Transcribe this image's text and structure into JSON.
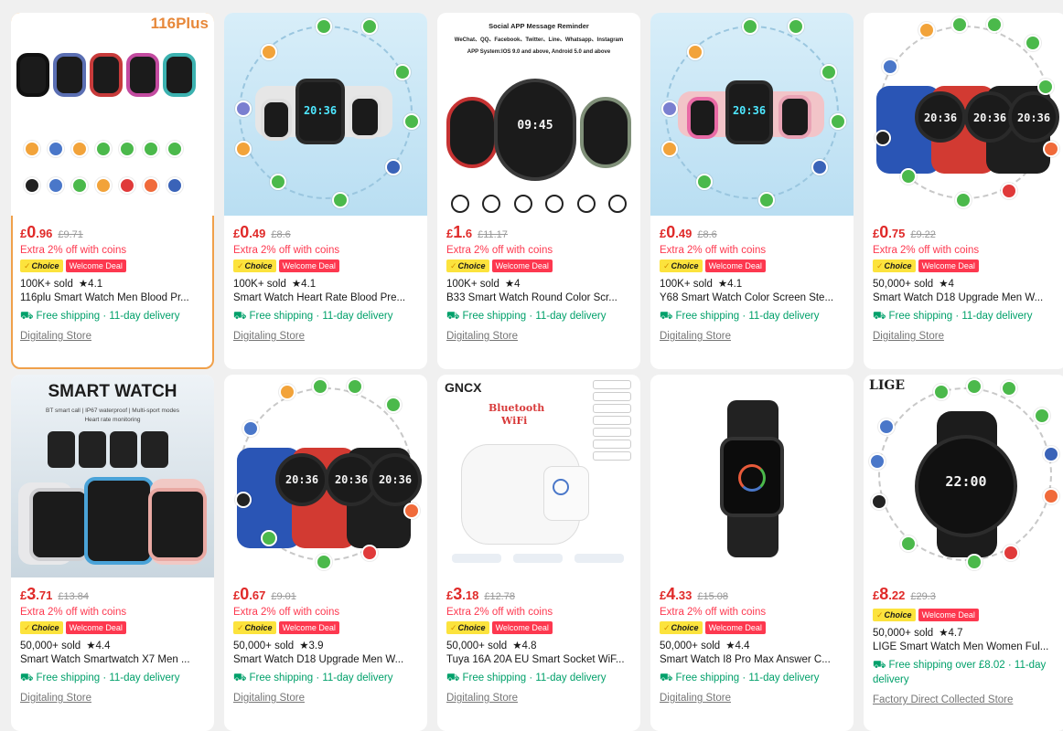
{
  "products": [
    {
      "price_symbol": "£",
      "price_int": "0",
      "price_dec": ".96",
      "orig_price": "£9.71",
      "promo": "Extra 2% off with coins",
      "choice": "Choice",
      "deal": "Welcome Deal",
      "sold": "100K+ sold",
      "rating": "★4.1",
      "title": "116plu Smart Watch Men Blood Pr...",
      "shipping": "Free shipping · 11-day delivery",
      "store": "Digitaling Store",
      "image_text": "116Plus"
    },
    {
      "price_symbol": "£",
      "price_int": "0",
      "price_dec": ".49",
      "orig_price": "£8.6",
      "promo": "Extra 2% off with coins",
      "choice": "Choice",
      "deal": "Welcome Deal",
      "sold": "100K+ sold",
      "rating": "★4.1",
      "title": "Smart Watch Heart Rate Blood Pre...",
      "shipping": "Free shipping · 11-day delivery",
      "store": "Digitaling Store",
      "image_text": "20:36"
    },
    {
      "price_symbol": "£",
      "price_int": "1",
      "price_dec": ".6",
      "orig_price": "£11.17",
      "promo": "Extra 2% off with coins",
      "choice": "Choice",
      "deal": "Welcome Deal",
      "sold": "100K+ sold",
      "rating": "★4",
      "title": "B33 Smart Watch Round Color Scr...",
      "shipping": "Free shipping · 11-day delivery",
      "store": "Digitaling Store",
      "image_text": "Social APP Message Reminder",
      "image_subtext": "WeChat、QQ、Facebook、Twitter、Line、Whatsapp、Instagram",
      "image_subtext2": "APP System:IOS 9.0 and above, Android 5.0 and above"
    },
    {
      "price_symbol": "£",
      "price_int": "0",
      "price_dec": ".49",
      "orig_price": "£8.6",
      "promo": "Extra 2% off with coins",
      "choice": "Choice",
      "deal": "Welcome Deal",
      "sold": "100K+ sold",
      "rating": "★4.1",
      "title": "Y68 Smart Watch Color Screen Ste...",
      "shipping": "Free shipping · 11-day delivery",
      "store": "Digitaling Store",
      "image_text": "20:36"
    },
    {
      "price_symbol": "£",
      "price_int": "0",
      "price_dec": ".75",
      "orig_price": "£9.22",
      "promo": "Extra 2% off with coins",
      "choice": "Choice",
      "deal": "Welcome Deal",
      "sold": "50,000+ sold",
      "rating": "★4",
      "title": "Smart Watch D18 Upgrade Men W...",
      "shipping": "Free shipping · 11-day delivery",
      "store": "Digitaling Store",
      "image_text": "20:36"
    },
    {
      "price_symbol": "£",
      "price_int": "3",
      "price_dec": ".71",
      "orig_price": "£13.84",
      "promo": "Extra 2% off with coins",
      "choice": "Choice",
      "deal": "Welcome Deal",
      "sold": "50,000+ sold",
      "rating": "★4.4",
      "title": "Smart Watch Smartwatch X7 Men ...",
      "shipping": "Free shipping · 11-day delivery",
      "store": "Digitaling Store",
      "image_text": "SMART WATCH",
      "image_subtext": "BT smart call | IP67 waterproof | Multi-sport modes",
      "image_subtext2": "Heart rate monitoring"
    },
    {
      "price_symbol": "£",
      "price_int": "0",
      "price_dec": ".67",
      "orig_price": "£9.01",
      "promo": "Extra 2% off with coins",
      "choice": "Choice",
      "deal": "Welcome Deal",
      "sold": "50,000+ sold",
      "rating": "★3.9",
      "title": "Smart Watch D18 Upgrade Men W...",
      "shipping": "Free shipping · 11-day delivery",
      "store": "Digitaling Store",
      "image_text": "20:36"
    },
    {
      "price_symbol": "£",
      "price_int": "3",
      "price_dec": ".18",
      "orig_price": "£12.78",
      "promo": "Extra 2% off with coins",
      "choice": "Choice",
      "deal": "Welcome Deal",
      "sold": "50,000+ sold",
      "rating": "★4.8",
      "title": "Tuya 16A 20A EU Smart Socket WiF...",
      "shipping": "Free shipping · 11-day delivery",
      "store": "Digitaling Store",
      "image_text": "GNCX",
      "image_subtext": "Bluetooth",
      "image_subtext2": "WiFi"
    },
    {
      "price_symbol": "£",
      "price_int": "4",
      "price_dec": ".33",
      "orig_price": "£15.08",
      "promo": "Extra 2% off with coins",
      "choice": "Choice",
      "deal": "Welcome Deal",
      "sold": "50,000+ sold",
      "rating": "★4.4",
      "title": "Smart Watch I8 Pro Max Answer C...",
      "shipping": "Free shipping · 11-day delivery",
      "store": "Digitaling Store"
    },
    {
      "price_symbol": "£",
      "price_int": "8",
      "price_dec": ".22",
      "orig_price": "£29.3",
      "promo": "",
      "choice": "Choice",
      "deal": "Welcome Deal",
      "sold": "50,000+ sold",
      "rating": "★4.7",
      "title": "LIGE Smart Watch Men Women Ful...",
      "shipping": "Free shipping over £8.02 · 11-day delivery",
      "store": "Factory Direct Collected Store",
      "image_text": "LIGE",
      "image_subtext": "22:00"
    }
  ],
  "colors": {
    "price": "#e02a29",
    "promo": "#fd384f",
    "shipping": "#00a06a",
    "choice": "#fce33d",
    "selected_outline": "#f0a04a"
  }
}
